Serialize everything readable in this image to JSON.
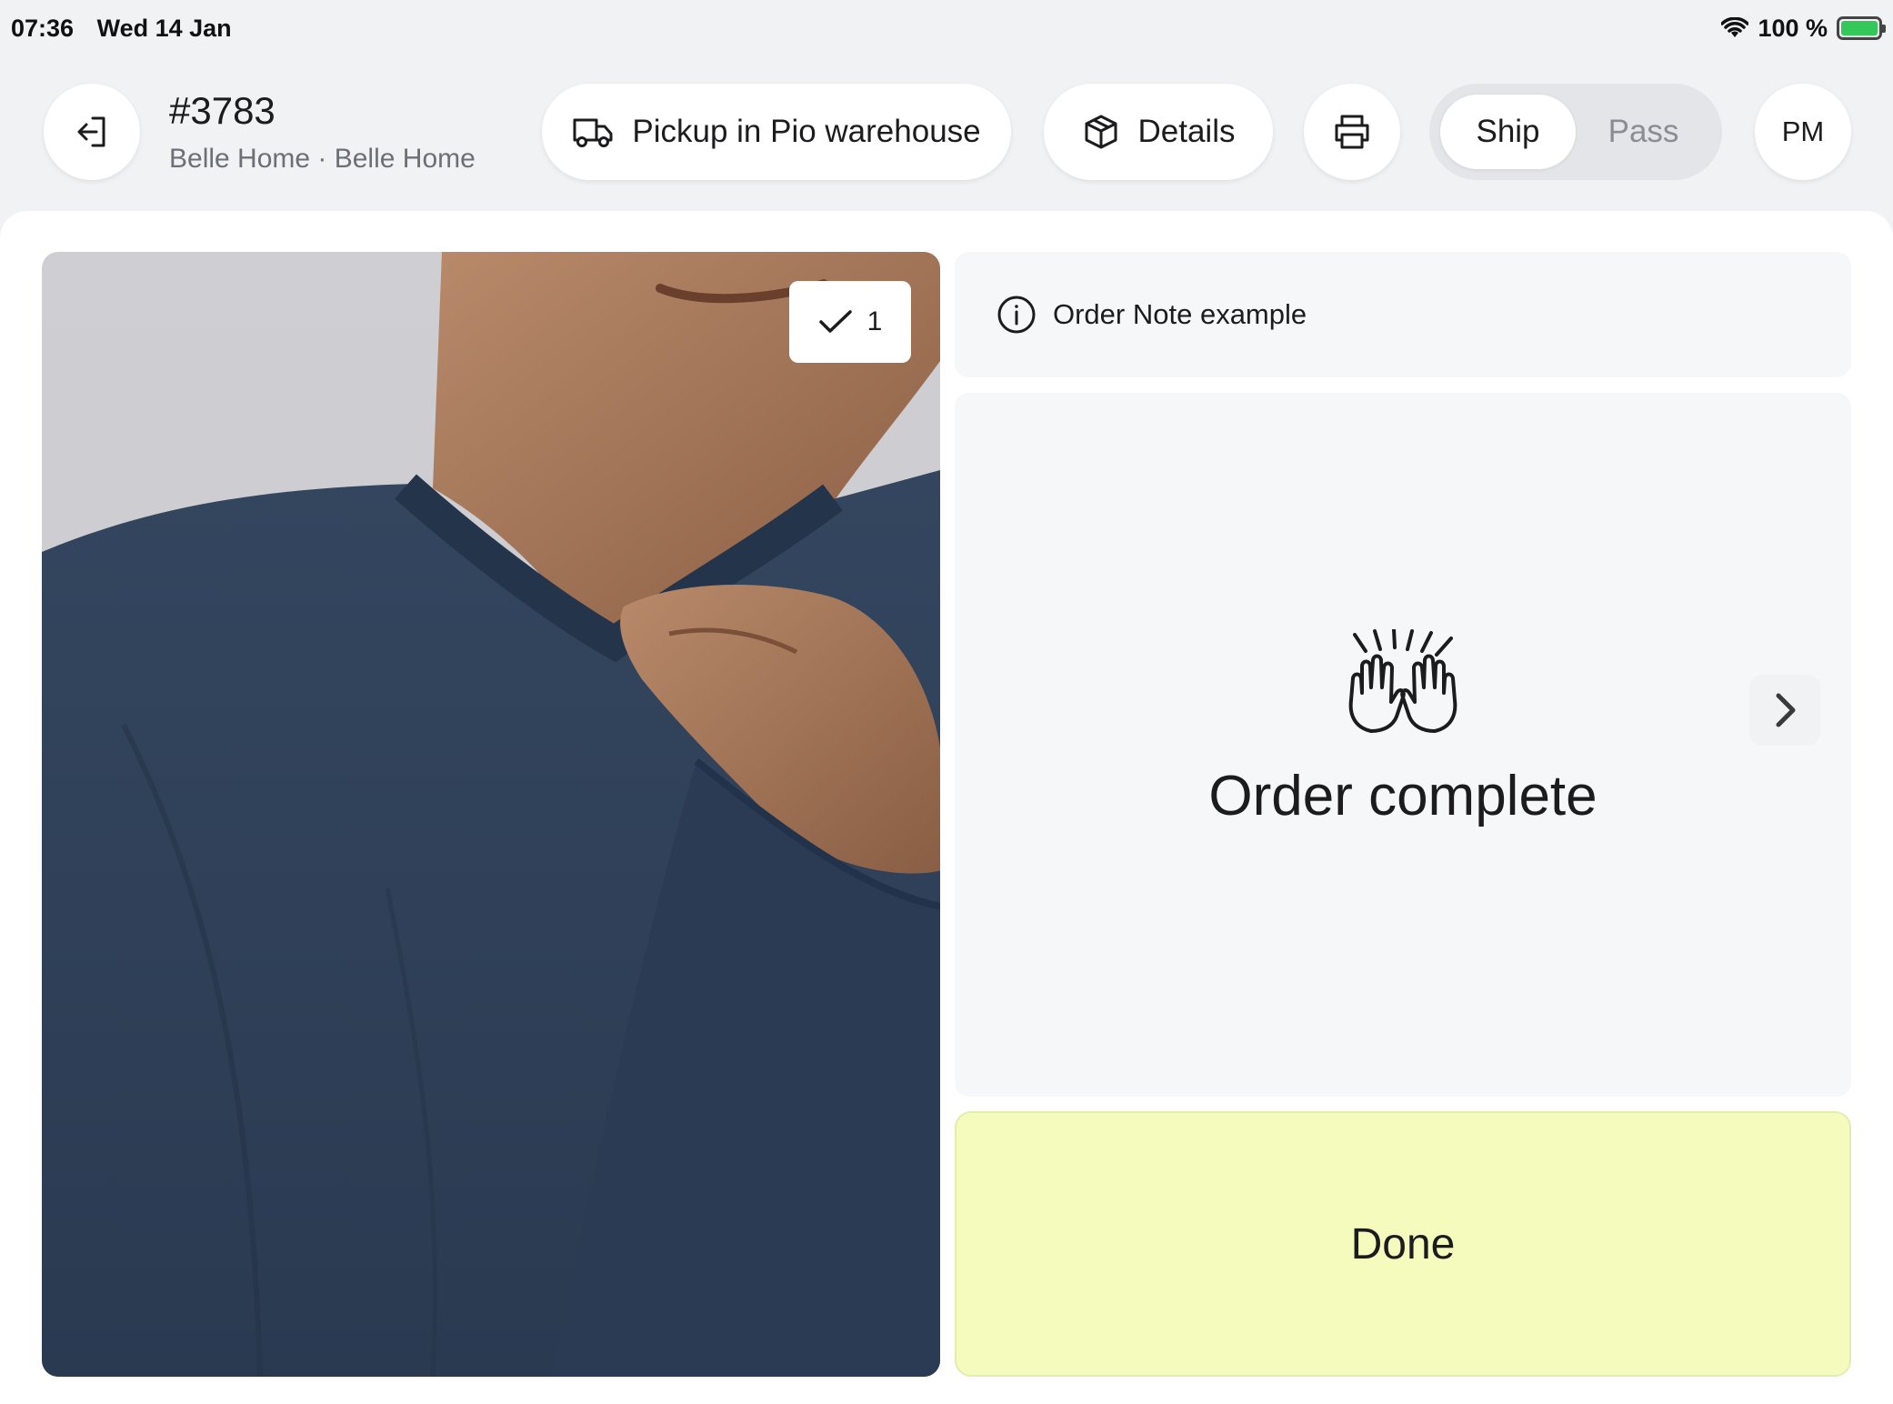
{
  "status_bar": {
    "time": "07:36",
    "date": "Wed 14 Jan",
    "battery": "100 %",
    "icons": [
      "wifi-icon",
      "battery-charging-icon"
    ]
  },
  "header": {
    "order_number": "#3783",
    "store_line": "Belle Home · Belle Home",
    "pickup_label": "Pickup in Pio warehouse",
    "details_label": "Details",
    "toggle": {
      "ship": "Ship",
      "pass": "Pass",
      "selected": "Ship"
    },
    "user_initials": "PM"
  },
  "product": {
    "checked_count": "1"
  },
  "note": {
    "text": "Order Note example"
  },
  "status": {
    "title": "Order complete"
  },
  "actions": {
    "done_label": "Done"
  },
  "colors": {
    "done_bg": "#f4fbbd",
    "panel_bg": "#f6f7f9",
    "app_bg": "#f1f2f4",
    "sweater": "#2e3f57"
  }
}
